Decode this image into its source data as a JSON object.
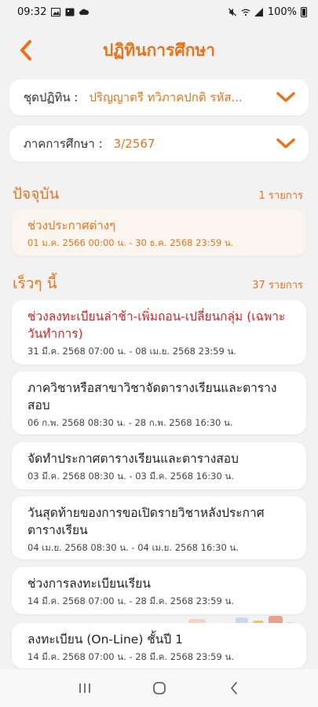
{
  "status_bar": {
    "time": "09:32",
    "battery": "100%",
    "icons": [
      "gallery-icon",
      "image-icon",
      "cloud-icon",
      "mute-icon",
      "wifi-icon",
      "signal-icon",
      "battery-icon"
    ]
  },
  "header": {
    "title": "ปฏิทินการศึกษา",
    "back_icon": "chevron-left-icon"
  },
  "calendar_selector": {
    "label": "ชุดปฏิทิน :",
    "value": "ปริญญาตรี ทวิภาคปกติ รหัส..."
  },
  "term_selector": {
    "label": "ภาคการศึกษา :",
    "value": "3/2567"
  },
  "current_section": {
    "title": "ปัจจุบัน",
    "count": "1 รายการ",
    "items": [
      {
        "title": "ช่วงประกาศต่างๆ",
        "date": "01 ม.ค. 2566 00:00 น. - 30 ธ.ค. 2568 23:59 น."
      }
    ]
  },
  "recent_section": {
    "title": "เร็วๆ นี้",
    "count": "37 รายการ",
    "items": [
      {
        "title": "ช่วงลงทะเบียนล่าช้า-เพิ่มถอน-เปลี่ยนกลุ่ม (เฉพาะวันทำการ)",
        "date": "31 มี.ค. 2568 07:00 น. - 08 เม.ย. 2568 23:59 น."
      },
      {
        "title": "ภาควิชาหรือสาขาวิชาจัดตารางเรียนและตารางสอบ",
        "date": "06 ก.พ. 2568 08:30 น. - 28 ก.พ. 2568 16:30 น."
      },
      {
        "title": "จัดทำประกาศตารางเรียนและตารางสอบ",
        "date": "03 มี.ค. 2568 08:30 น. - 03 มี.ค. 2568 16:30 น."
      },
      {
        "title": "วันสุดท้ายของการขอเปิดรายวิชาหลังประกาศตารางเรียน",
        "date": "04 เม.ย. 2568 08:30 น. - 04 เม.ย. 2568 16:30 น."
      },
      {
        "title": "ช่วงการลงทะเบียนเรียน",
        "date": "14 มี.ค. 2568 07:00 น. - 28 มี.ค. 2568 23:59 น."
      },
      {
        "title": "ลงทะเบียน (On-Line) ชั้นปี 1",
        "date": "14 มี.ค. 2568 07:00 น. - 28 มี.ค. 2568 23:59 น."
      }
    ]
  },
  "colors": {
    "accent": "#e8731a",
    "alert": "#d91f1f",
    "background": "#f2f2f2"
  }
}
